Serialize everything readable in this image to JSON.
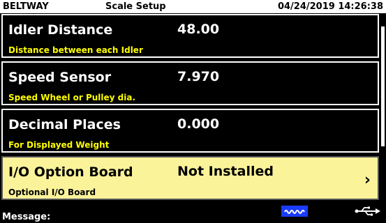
{
  "header": {
    "brand": "BELTWAY",
    "title": "Scale Setup",
    "datetime": "04/24/2019 14:26:38"
  },
  "rows": [
    {
      "label": "Idler Distance",
      "value": "48.00",
      "description": "Distance between each Idler"
    },
    {
      "label": "Speed Sensor",
      "value": "7.970",
      "description": "Speed Wheel or Pulley dia."
    },
    {
      "label": "Decimal Places",
      "value": "0.000",
      "description": "For Displayed Weight"
    },
    {
      "label": "I/O Option Board",
      "value": "Not Installed",
      "description": "Optional I/O Board",
      "selected": true,
      "chevron": "›"
    }
  ],
  "footer": {
    "message_label": "Message:",
    "status_icons": [
      "wave-icon",
      "usb-icon"
    ]
  },
  "colors": {
    "header_bg": "#ffffff",
    "screen_bg": "#000000",
    "description_text": "#ffff00",
    "selected_bg": "#fbf39a",
    "wave_icon_bg": "#1a3cff"
  }
}
